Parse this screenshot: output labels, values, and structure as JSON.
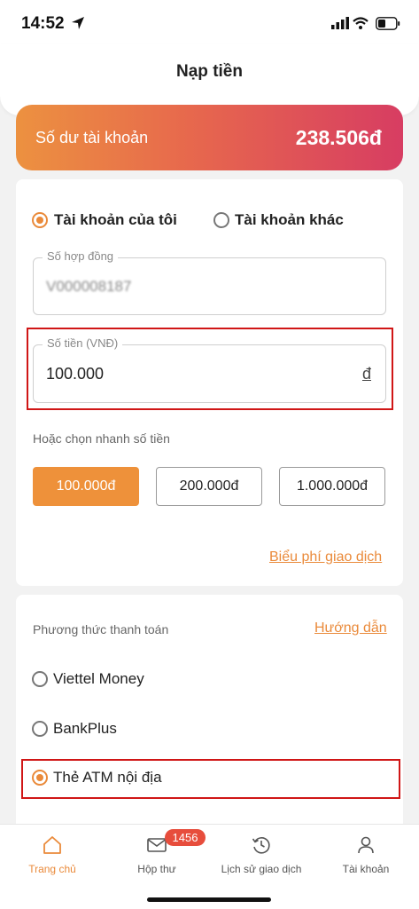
{
  "status_bar": {
    "time": "14:52"
  },
  "header": {
    "title": "Nạp tiền"
  },
  "balance": {
    "label": "Số dư tài khoản",
    "value": "238.506đ"
  },
  "account_type": {
    "options": [
      {
        "label": "Tài khoản của tôi",
        "selected": true
      },
      {
        "label": "Tài khoản khác",
        "selected": false
      }
    ]
  },
  "contract_field": {
    "label": "Số hợp đồng",
    "value": "V000008187"
  },
  "amount_field": {
    "label": "Số tiền (VNĐ)",
    "value": "100.000",
    "currency": "đ"
  },
  "quick_amounts": {
    "label": "Hoặc chọn nhanh số tiền",
    "options": [
      "100.000đ",
      "200.000đ",
      "1.000.000đ"
    ],
    "selected_index": 0
  },
  "fee_link": "Biểu phí giao dịch",
  "payment_methods": {
    "title": "Phương thức thanh toán",
    "guide_link": "Hướng dẫn",
    "options": [
      {
        "label": "Viettel Money",
        "selected": false
      },
      {
        "label": "BankPlus",
        "selected": false
      },
      {
        "label": "Thẻ ATM nội địa",
        "selected": true
      }
    ]
  },
  "tabbar": {
    "items": [
      {
        "label": "Trang chủ",
        "icon": "home-icon",
        "active": true
      },
      {
        "label": "Hộp thư",
        "icon": "mail-icon",
        "active": false,
        "badge": "1456"
      },
      {
        "label": "Lịch sử giao dịch",
        "icon": "history-icon",
        "active": false
      },
      {
        "label": "Tài khoản",
        "icon": "user-icon",
        "active": false
      }
    ]
  },
  "colors": {
    "accent": "#ea8a3a",
    "gradient_start": "#ec9140",
    "gradient_end": "#d73d62",
    "highlight": "#d01616"
  }
}
